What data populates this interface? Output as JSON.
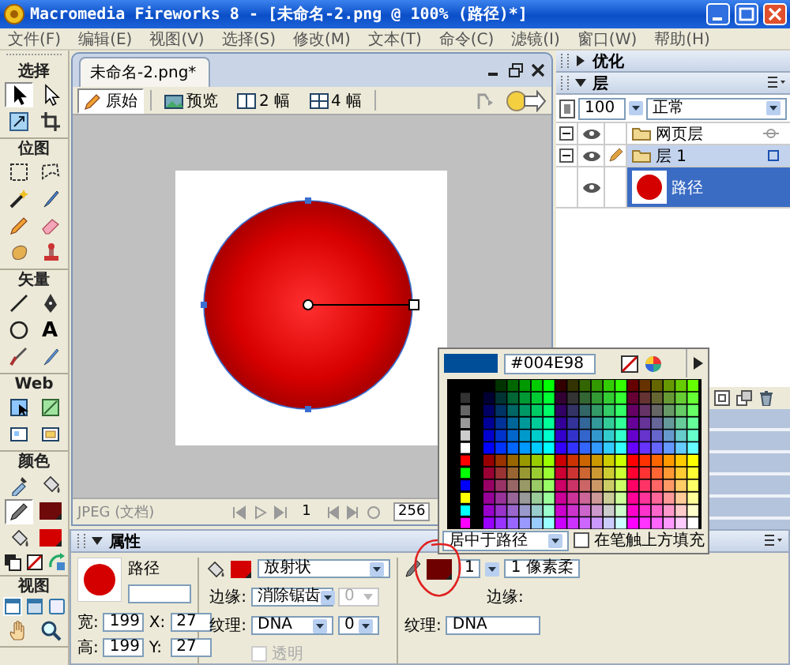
{
  "window": {
    "title": "Macromedia Fireworks 8 - [未命名-2.png @ 100% (路径)*]"
  },
  "menu": [
    "文件(F)",
    "编辑(E)",
    "视图(V)",
    "选择(S)",
    "修改(M)",
    "文本(T)",
    "命令(C)",
    "滤镜(I)",
    "窗口(W)",
    "帮助(H)"
  ],
  "toolbox": [
    {
      "title": "选择",
      "tools": [
        {
          "kind": "tool",
          "selected": true
        },
        {
          "kind": "tool",
          "selected": false
        },
        {
          "kind": "tool",
          "selected": false
        },
        {
          "kind": "tool",
          "selected": false
        }
      ]
    },
    {
      "title": "位图",
      "tools": [
        {
          "kind": "tool",
          "selected": false
        },
        {
          "kind": "tool",
          "selected": false
        },
        {
          "kind": "tool",
          "selected": false
        },
        {
          "kind": "tool",
          "selected": false
        },
        {
          "kind": "tool",
          "selected": false
        },
        {
          "kind": "tool",
          "selected": false
        },
        {
          "kind": "tool",
          "selected": false
        },
        {
          "kind": "tool",
          "selected": false
        }
      ]
    },
    {
      "title": "矢量",
      "tools": [
        {
          "kind": "tool",
          "selected": false
        },
        {
          "kind": "tool",
          "selected": false
        },
        {
          "kind": "tool",
          "selected": false
        },
        {
          "kind": "glyph",
          "glyph": "A",
          "selected": false
        },
        {
          "kind": "tool",
          "selected": false
        },
        {
          "kind": "tool",
          "selected": false
        }
      ]
    },
    {
      "title": "Web",
      "tools": [
        {
          "kind": "tool",
          "selected": false
        },
        {
          "kind": "tool",
          "selected": false
        },
        {
          "kind": "tool",
          "selected": false
        },
        {
          "kind": "tool",
          "selected": false
        }
      ]
    },
    {
      "title": "颜色",
      "tools": [
        {
          "kind": "tool",
          "selected": false
        },
        {
          "kind": "tool",
          "selected": false
        },
        {
          "kind": "tool",
          "selected": true
        },
        {
          "kind": "swatch",
          "color": "#6e0a0a"
        },
        {
          "kind": "tool",
          "selected": false
        },
        {
          "kind": "swatch",
          "color": "#d40000"
        },
        {
          "kind": "tool",
          "selected": false
        },
        {
          "kind": "tool",
          "selected": false
        },
        {
          "kind": "tool",
          "selected": false
        }
      ]
    },
    {
      "title": "视图",
      "tools": [
        {
          "kind": "tool",
          "selected": true
        },
        {
          "kind": "tool",
          "selected": false
        },
        {
          "kind": "tool",
          "selected": false
        },
        {
          "kind": "tool",
          "selected": false
        },
        {
          "kind": "tool",
          "selected": false
        }
      ]
    }
  ],
  "document": {
    "tab": "未命名-2.png*",
    "views": [
      {
        "label": "原始",
        "selected": true
      },
      {
        "label": "预览",
        "selected": false
      },
      {
        "label": "2 幅",
        "selected": false
      },
      {
        "label": "4 幅",
        "selected": false
      }
    ],
    "status": "JPEG (文档)",
    "frame": "1",
    "zoom": "256"
  },
  "panels": [
    {
      "title": "优化",
      "expanded": false
    },
    {
      "title": "层",
      "expanded": true
    }
  ],
  "layers": {
    "opacity": "100",
    "blend": "正常",
    "items": [
      {
        "name": "网页层",
        "expanded": true,
        "selected": false
      },
      {
        "name": "层 1",
        "expanded": true,
        "selected": true,
        "children": [
          {
            "name": "路径",
            "selected": true
          }
        ]
      }
    ]
  },
  "color_popup": {
    "color": "#004e98",
    "hex": "#004E98",
    "placement": "居中于路径",
    "fill_over_stroke": {
      "label": "在笔触上方填充",
      "checked": false
    }
  },
  "properties": {
    "title": "属性",
    "expanded": true,
    "object": "路径",
    "size": [
      {
        "label": "宽:",
        "value": "199"
      },
      {
        "label": "X:",
        "value": "27"
      },
      {
        "label": "高:",
        "value": "199"
      },
      {
        "label": "Y:",
        "value": "27"
      }
    ],
    "fill": {
      "color": "#d40000",
      "type": "放射状",
      "edge_label": "边缘:",
      "edge": "消除锯齿",
      "edge_amount": "0",
      "edge_amount_disabled": true,
      "texture_label": "纹理:",
      "texture": "DNA",
      "texture_amount": "0",
      "transparent": {
        "label": "透明",
        "checked": false,
        "disabled": true
      }
    },
    "stroke": {
      "color": "#6e0000",
      "size": "1",
      "type": "1 像素柔",
      "edge_label": "边缘:",
      "texture_label": "纹理:",
      "texture": "DNA"
    }
  }
}
